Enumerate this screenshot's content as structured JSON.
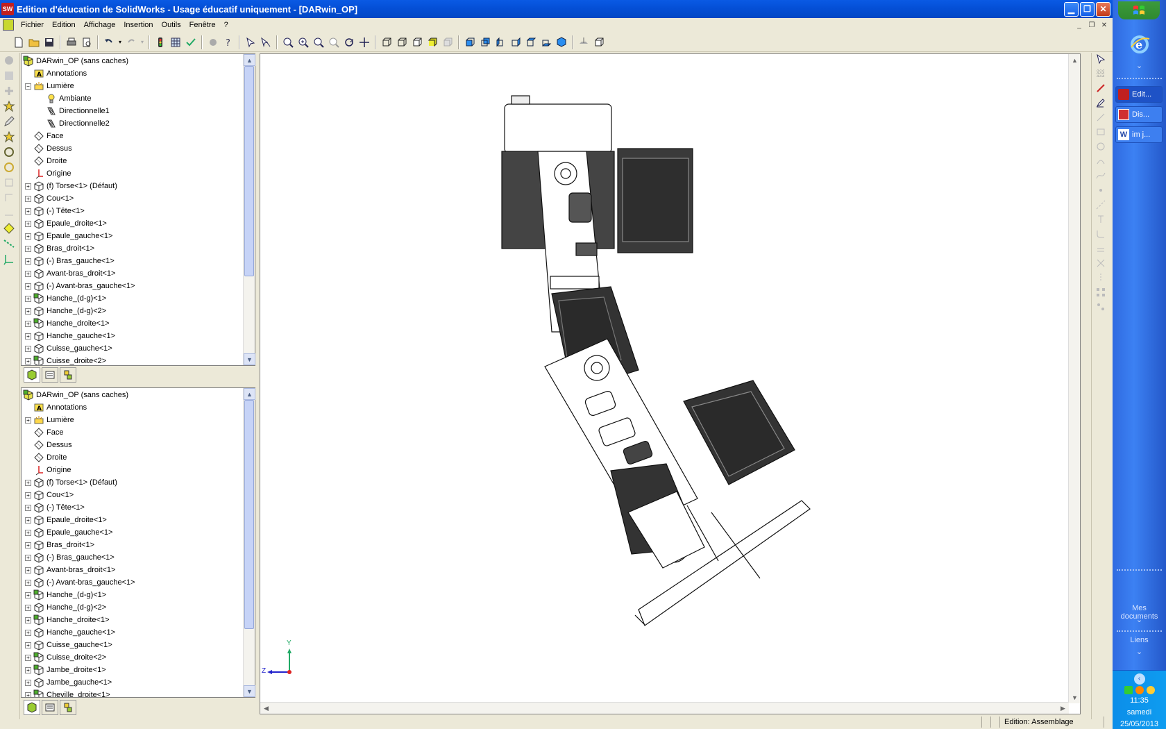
{
  "window": {
    "title": "Edition d'éducation de SolidWorks - Usage éducatif uniquement - [DARwin_OP]",
    "app_badge": "SW"
  },
  "menu": [
    "Fichier",
    "Edition",
    "Affichage",
    "Insertion",
    "Outils",
    "Fenêtre",
    "?"
  ],
  "tree1": {
    "nodes": [
      {
        "label": "DARwin_OP  (sans caches)",
        "level": 0,
        "icon": "assembly-icon",
        "exp": ""
      },
      {
        "label": "Annotations",
        "level": 1,
        "icon": "annotations-icon",
        "exp": ""
      },
      {
        "label": "Lumière",
        "level": 1,
        "icon": "lights-icon",
        "exp": "-"
      },
      {
        "label": "Ambiante",
        "level": 2,
        "icon": "bulb-icon",
        "exp": ""
      },
      {
        "label": "Directionnelle1",
        "level": 2,
        "icon": "directional-light-icon",
        "exp": ""
      },
      {
        "label": "Directionnelle2",
        "level": 2,
        "icon": "directional-light-icon",
        "exp": ""
      },
      {
        "label": "Face",
        "level": 1,
        "icon": "plane-icon",
        "exp": ""
      },
      {
        "label": "Dessus",
        "level": 1,
        "icon": "plane-icon",
        "exp": ""
      },
      {
        "label": "Droite",
        "level": 1,
        "icon": "plane-icon",
        "exp": ""
      },
      {
        "label": "Origine",
        "level": 1,
        "icon": "origin-icon",
        "exp": ""
      },
      {
        "label": "(f) Torse<1> (Défaut)",
        "level": 1,
        "icon": "part-icon",
        "exp": "+"
      },
      {
        "label": "Cou<1>",
        "level": 1,
        "icon": "part-icon",
        "exp": "+"
      },
      {
        "label": "(-) Tête<1>",
        "level": 1,
        "icon": "part-icon",
        "exp": "+"
      },
      {
        "label": "Epaule_droite<1>",
        "level": 1,
        "icon": "part-icon",
        "exp": "+"
      },
      {
        "label": "Epaule_gauche<1>",
        "level": 1,
        "icon": "part-icon",
        "exp": "+"
      },
      {
        "label": "Bras_droit<1>",
        "level": 1,
        "icon": "part-icon",
        "exp": "+"
      },
      {
        "label": "(-) Bras_gauche<1>",
        "level": 1,
        "icon": "part-icon",
        "exp": "+"
      },
      {
        "label": "Avant-bras_droit<1>",
        "level": 1,
        "icon": "part-icon",
        "exp": "+"
      },
      {
        "label": "(-) Avant-bras_gauche<1>",
        "level": 1,
        "icon": "part-icon",
        "exp": "+"
      },
      {
        "label": "Hanche_(d-g)<1>",
        "level": 1,
        "icon": "part-green-icon",
        "exp": "+"
      },
      {
        "label": "Hanche_(d-g)<2>",
        "level": 1,
        "icon": "part-icon",
        "exp": "+"
      },
      {
        "label": "Hanche_droite<1>",
        "level": 1,
        "icon": "part-green-icon",
        "exp": "+"
      },
      {
        "label": "Hanche_gauche<1>",
        "level": 1,
        "icon": "part-icon",
        "exp": "+"
      },
      {
        "label": "Cuisse_gauche<1>",
        "level": 1,
        "icon": "part-icon",
        "exp": "+"
      },
      {
        "label": "Cuisse_droite<2>",
        "level": 1,
        "icon": "part-green-icon",
        "exp": "+"
      }
    ]
  },
  "tree2": {
    "nodes": [
      {
        "label": "DARwin_OP  (sans caches)",
        "level": 0,
        "icon": "assembly-icon",
        "exp": ""
      },
      {
        "label": "Annotations",
        "level": 1,
        "icon": "annotations-icon",
        "exp": ""
      },
      {
        "label": "Lumière",
        "level": 1,
        "icon": "lights-icon",
        "exp": "+"
      },
      {
        "label": "Face",
        "level": 1,
        "icon": "plane-icon",
        "exp": ""
      },
      {
        "label": "Dessus",
        "level": 1,
        "icon": "plane-icon",
        "exp": ""
      },
      {
        "label": "Droite",
        "level": 1,
        "icon": "plane-icon",
        "exp": ""
      },
      {
        "label": "Origine",
        "level": 1,
        "icon": "origin-icon",
        "exp": ""
      },
      {
        "label": "(f) Torse<1> (Défaut)",
        "level": 1,
        "icon": "part-icon",
        "exp": "+"
      },
      {
        "label": "Cou<1>",
        "level": 1,
        "icon": "part-icon",
        "exp": "+"
      },
      {
        "label": "(-) Tête<1>",
        "level": 1,
        "icon": "part-icon",
        "exp": "+"
      },
      {
        "label": "Epaule_droite<1>",
        "level": 1,
        "icon": "part-icon",
        "exp": "+"
      },
      {
        "label": "Epaule_gauche<1>",
        "level": 1,
        "icon": "part-icon",
        "exp": "+"
      },
      {
        "label": "Bras_droit<1>",
        "level": 1,
        "icon": "part-icon",
        "exp": "+"
      },
      {
        "label": "(-) Bras_gauche<1>",
        "level": 1,
        "icon": "part-icon",
        "exp": "+"
      },
      {
        "label": "Avant-bras_droit<1>",
        "level": 1,
        "icon": "part-icon",
        "exp": "+"
      },
      {
        "label": "(-) Avant-bras_gauche<1>",
        "level": 1,
        "icon": "part-icon",
        "exp": "+"
      },
      {
        "label": "Hanche_(d-g)<1>",
        "level": 1,
        "icon": "part-green-icon",
        "exp": "+"
      },
      {
        "label": "Hanche_(d-g)<2>",
        "level": 1,
        "icon": "part-icon",
        "exp": "+"
      },
      {
        "label": "Hanche_droite<1>",
        "level": 1,
        "icon": "part-green-icon",
        "exp": "+"
      },
      {
        "label": "Hanche_gauche<1>",
        "level": 1,
        "icon": "part-icon",
        "exp": "+"
      },
      {
        "label": "Cuisse_gauche<1>",
        "level": 1,
        "icon": "part-icon",
        "exp": "+"
      },
      {
        "label": "Cuisse_droite<2>",
        "level": 1,
        "icon": "part-green-icon",
        "exp": "+"
      },
      {
        "label": "Jambe_droite<1>",
        "level": 1,
        "icon": "part-green-icon",
        "exp": "+"
      },
      {
        "label": "Jambe_gauche<1>",
        "level": 1,
        "icon": "part-icon",
        "exp": "+"
      },
      {
        "label": "Cheville_droite<1>",
        "level": 1,
        "icon": "part-green-icon",
        "exp": "+"
      }
    ]
  },
  "viewport": {
    "axis_y": "Y",
    "axis_z": "Z"
  },
  "status": {
    "mode": "Edition: Assemblage"
  },
  "taskbar": {
    "buttons": [
      {
        "label": "Edit...",
        "icon": "solidworks-icon",
        "active": true
      },
      {
        "label": "Dis...",
        "icon": "app-red-icon",
        "active": false
      },
      {
        "label": "im j...",
        "icon": "word-icon",
        "active": false
      }
    ],
    "mes_documents": "Mes documents",
    "liens": "Liens",
    "time": "11:35",
    "day": "samedi",
    "date": "25/05/2013"
  },
  "colors": {
    "titlebar": "#0550d8",
    "taskbar": "#3c81f3",
    "tray": "#0f9cf0",
    "selection_green": "#4caf2a"
  }
}
